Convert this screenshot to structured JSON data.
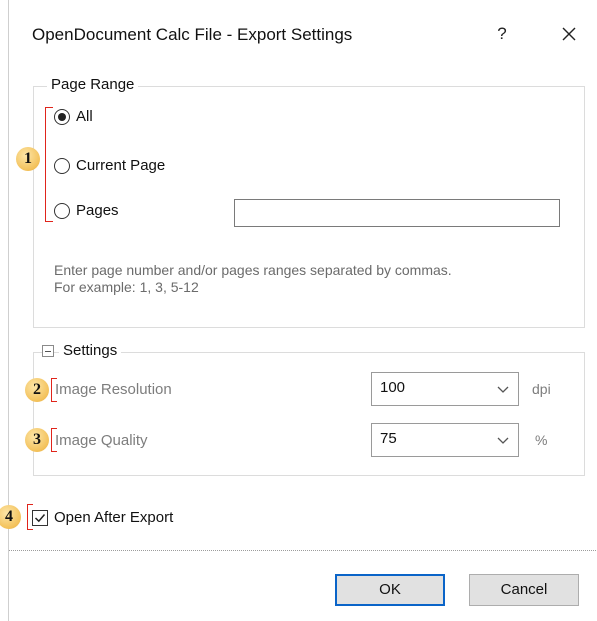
{
  "dialog": {
    "title": "OpenDocument Calc File - Export Settings",
    "help_label": "?"
  },
  "page_range": {
    "legend": "Page Range",
    "options": [
      {
        "label": "All",
        "selected": true
      },
      {
        "label": "Current Page",
        "selected": false
      },
      {
        "label": "Pages",
        "selected": false
      }
    ],
    "pages_value": "",
    "hint_line1": "Enter page number and/or pages ranges separated by commas.",
    "hint_line2": "For example: 1, 3, 5-12"
  },
  "settings": {
    "legend": "Settings",
    "image_resolution": {
      "label": "Image Resolution",
      "value": "100",
      "unit": "dpi"
    },
    "image_quality": {
      "label": "Image Quality",
      "value": "75",
      "unit": "%"
    }
  },
  "open_after_export": {
    "label": "Open After Export",
    "checked": true
  },
  "buttons": {
    "ok": "OK",
    "cancel": "Cancel"
  },
  "annotations": {
    "badge1": "1",
    "badge2": "2",
    "badge3": "3",
    "badge4": "4"
  },
  "colors": {
    "marker_red": "#e0241b",
    "badge_gold": "#f3c15a",
    "default_button_border": "#0a64c8"
  }
}
